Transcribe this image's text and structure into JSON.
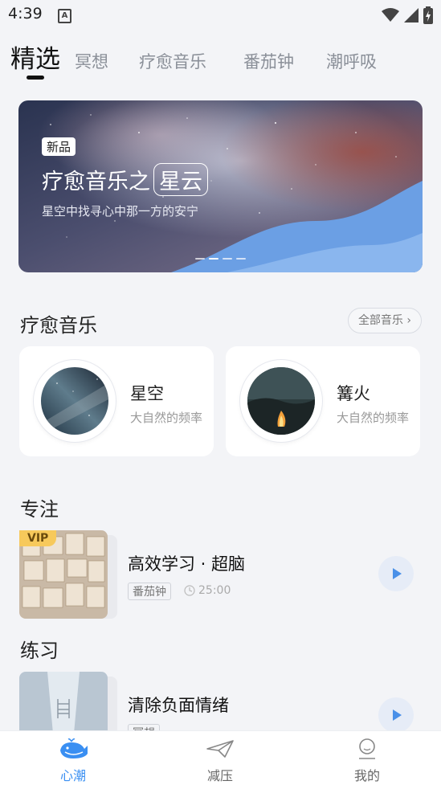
{
  "status_bar": {
    "time": "4:39",
    "a_icon": "A"
  },
  "tabs": [
    {
      "label": "精选",
      "active": true
    },
    {
      "label": "冥想"
    },
    {
      "label": "疗愈音乐"
    },
    {
      "label": "番茄钟"
    },
    {
      "label": "潮呼吸"
    }
  ],
  "banner": {
    "badge": "新品",
    "title_prefix": "疗愈音乐之",
    "title_highlight": "星云",
    "subtitle": "星空中找寻心中那一方的安宁"
  },
  "healing": {
    "title": "疗愈音乐",
    "see_all": "全部音乐",
    "cards": [
      {
        "name": "星空",
        "sub": "大自然的频率"
      },
      {
        "name": "篝火",
        "sub": "大自然的频率"
      }
    ]
  },
  "focus": {
    "title": "专注",
    "item": {
      "vip": "VIP",
      "title": "高效学习 · 超脑",
      "tag": "番茄钟",
      "duration": "25:00"
    }
  },
  "practice": {
    "title": "练习",
    "item": {
      "title": "清除负面情绪",
      "tag": "冥想"
    }
  },
  "bottom_nav": [
    {
      "label": "心潮",
      "active": true
    },
    {
      "label": "减压"
    },
    {
      "label": "我的"
    }
  ],
  "colors": {
    "accent": "#3a8ff2",
    "vip": "#f7c95b"
  }
}
